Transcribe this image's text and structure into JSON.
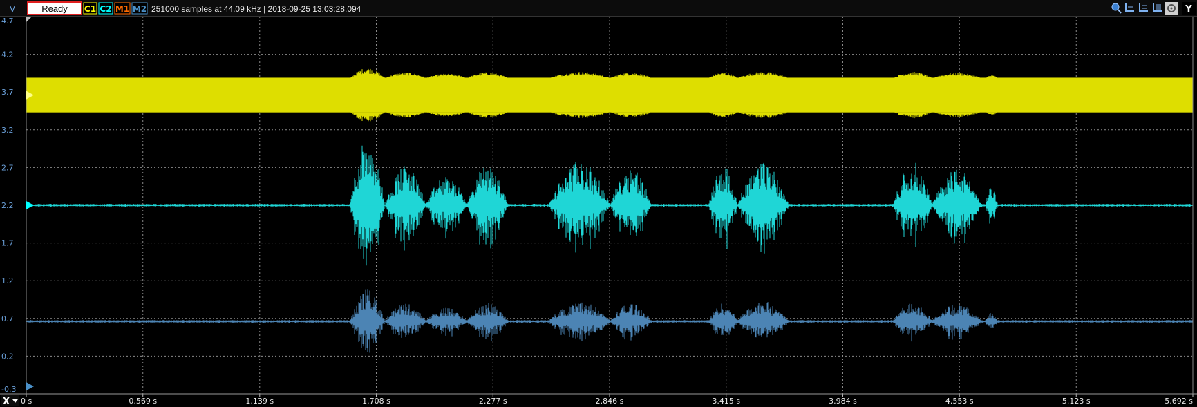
{
  "y_axis": {
    "unit": "V",
    "ticks": [
      "4.7",
      "4.2",
      "3.7",
      "3.2",
      "2.7",
      "2.2",
      "1.7",
      "1.2",
      "0.7",
      "0.2",
      "-0.3"
    ],
    "range": [
      -0.3,
      4.7
    ]
  },
  "x_axis": {
    "button": "X",
    "ticks": [
      "0 s",
      "0.569 s",
      "1.139 s",
      "1.708 s",
      "2.277 s",
      "2.846 s",
      "3.415 s",
      "3.984 s",
      "4.553 s",
      "5.123 s",
      "5.692 s"
    ],
    "range_s": [
      0,
      5.692
    ]
  },
  "status": {
    "label": "Ready"
  },
  "channels": [
    {
      "label": "C1",
      "color": "#ffff00"
    },
    {
      "label": "C2",
      "color": "#00ffff"
    },
    {
      "label": "M1",
      "color": "#ff6a00"
    },
    {
      "label": "M2",
      "color": "#4a90c8"
    }
  ],
  "info": "251000 samples at 44.09 kHz | 2018-09-25 13:03:28.094",
  "toolbar": {
    "icons": [
      "zoom-icon",
      "cursor-a-icon",
      "cursor-b-icon",
      "cursor-c-icon",
      "settings-icon"
    ],
    "y_button": "Y"
  },
  "traces": {
    "c1": {
      "color": "#dede00",
      "offset_v": 3.66,
      "half_band_v": 0.23
    },
    "c2": {
      "color": "#1fd6d6",
      "offset_v": 2.2
    },
    "m2": {
      "color": "#4c84b4",
      "offset_v": 0.66
    }
  }
}
